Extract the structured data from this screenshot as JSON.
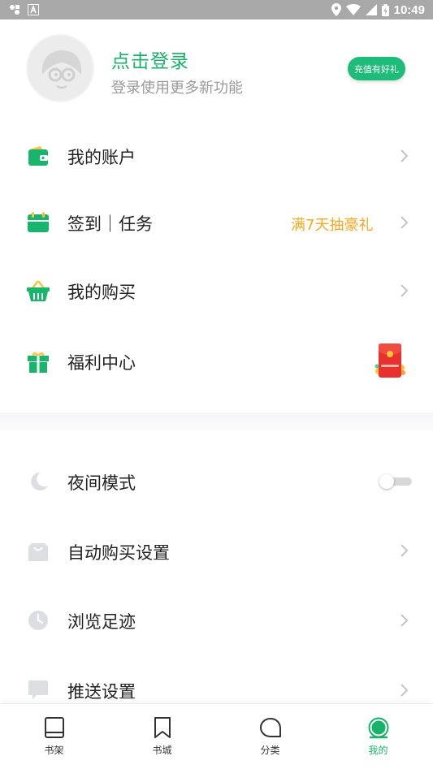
{
  "status_bar": {
    "time": "10:49"
  },
  "profile": {
    "login_title": "点击登录",
    "login_subtitle": "登录使用更多新功能",
    "recharge_label": "充值有好礼"
  },
  "menu": {
    "account": "我的账户",
    "checkin": "签到｜任务",
    "checkin_promo": "满7天抽豪礼",
    "purchases": "我的购买",
    "welfare": "福利中心",
    "night_mode": "夜间模式",
    "night_mode_on": false,
    "auto_buy": "自动购买设置",
    "history": "浏览足迹",
    "push": "推送设置"
  },
  "tabs": [
    {
      "label": "书架",
      "icon": "bookshelf-icon"
    },
    {
      "label": "书城",
      "icon": "bookmark-icon"
    },
    {
      "label": "分类",
      "icon": "category-icon"
    },
    {
      "label": "我的",
      "icon": "profile-icon"
    }
  ],
  "colors": {
    "accent": "#19b26a",
    "promo": "#f7a821",
    "icon_green": "#1ab56c",
    "icon_gray": "#d9dbde"
  }
}
